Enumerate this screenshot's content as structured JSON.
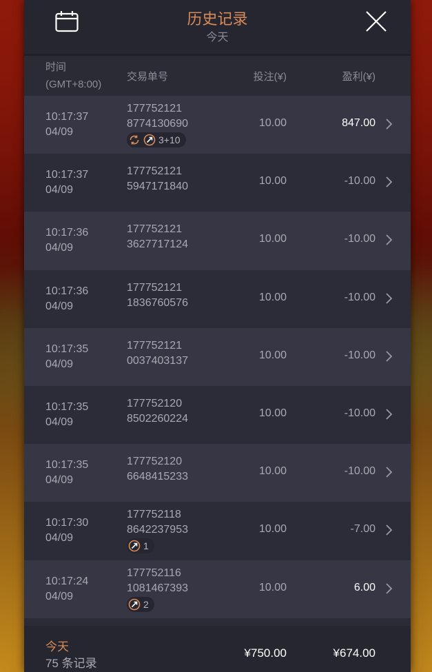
{
  "header": {
    "title": "历史记录",
    "subtitle": "今天"
  },
  "columns": {
    "time_line1": "时间",
    "time_line2": "(GMT+8:00)",
    "order": "交易单号",
    "bet": "投注(¥)",
    "profit": "盈利(¥)"
  },
  "rows": [
    {
      "time": "10:17:37",
      "date": "04/09",
      "order1": "177752121",
      "order2": "8774130690",
      "bet": "10.00",
      "profit": "847.00",
      "badge": "3+10"
    },
    {
      "time": "10:17:37",
      "date": "04/09",
      "order1": "177752121",
      "order2": "5947171840",
      "bet": "10.00",
      "profit": "-10.00"
    },
    {
      "time": "10:17:36",
      "date": "04/09",
      "order1": "177752121",
      "order2": "3627717124",
      "bet": "10.00",
      "profit": "-10.00"
    },
    {
      "time": "10:17:36",
      "date": "04/09",
      "order1": "177752121",
      "order2": "1836760576",
      "bet": "10.00",
      "profit": "-10.00"
    },
    {
      "time": "10:17:35",
      "date": "04/09",
      "order1": "177752121",
      "order2": "0037403137",
      "bet": "10.00",
      "profit": "-10.00"
    },
    {
      "time": "10:17:35",
      "date": "04/09",
      "order1": "177752120",
      "order2": "8502260224",
      "bet": "10.00",
      "profit": "-10.00"
    },
    {
      "time": "10:17:35",
      "date": "04/09",
      "order1": "177752120",
      "order2": "6648415233",
      "bet": "10.00",
      "profit": "-10.00"
    },
    {
      "time": "10:17:30",
      "date": "04/09",
      "order1": "177752118",
      "order2": "8642237953",
      "bet": "10.00",
      "profit": "-7.00",
      "badge": "1"
    },
    {
      "time": "10:17:24",
      "date": "04/09",
      "order1": "177752116",
      "order2": "1081467393",
      "bet": "10.00",
      "profit": "6.00",
      "badge": "2"
    }
  ],
  "footer": {
    "today": "今天",
    "records": "75 条记录",
    "total_bet": "¥750.00",
    "total_profit": "¥674.00"
  },
  "colors": {
    "accent": "#d88b57",
    "panel": "#2b2b36"
  }
}
